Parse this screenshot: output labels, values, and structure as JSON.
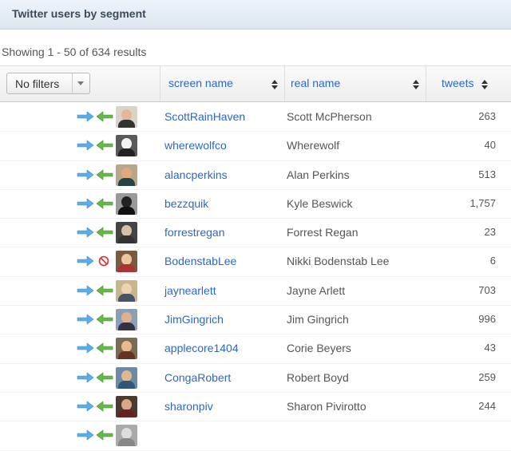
{
  "panel": {
    "title": "Twitter users by segment"
  },
  "results_text": "Showing 1 - 50 of 634 results",
  "filter": {
    "selected": "No filters"
  },
  "columns": {
    "screen_name": "screen name",
    "real_name": "real name",
    "tweets": "tweets"
  },
  "colors": {
    "link": "#2a68c7",
    "arrow_right": "#5aaee6",
    "arrow_left": "#66b84a",
    "block": "#d0302b"
  },
  "rows": [
    {
      "screen_name": "ScottRainHaven",
      "real_name": "Scott McPherson",
      "tweets": "263",
      "status_icon": "arrow-left-icon"
    },
    {
      "screen_name": "wherewolfco",
      "real_name": "Wherewolf",
      "tweets": "40",
      "status_icon": "arrow-left-icon"
    },
    {
      "screen_name": "alancperkins",
      "real_name": "Alan Perkins",
      "tweets": "513",
      "status_icon": "arrow-left-icon"
    },
    {
      "screen_name": "bezzquik",
      "real_name": "Kyle Beswick",
      "tweets": "1,757",
      "status_icon": "arrow-left-icon"
    },
    {
      "screen_name": "forrestregan",
      "real_name": "Forrest Regan",
      "tweets": "23",
      "status_icon": "arrow-left-icon"
    },
    {
      "screen_name": "BodenstabLee",
      "real_name": "Nikki Bodenstab Lee",
      "tweets": "6",
      "status_icon": "block-icon"
    },
    {
      "screen_name": "jaynearlett",
      "real_name": "Jayne Arlett",
      "tweets": "703",
      "status_icon": "arrow-left-icon"
    },
    {
      "screen_name": "JimGingrich",
      "real_name": "Jim Gingrich",
      "tweets": "996",
      "status_icon": "arrow-left-icon"
    },
    {
      "screen_name": "applecore1404",
      "real_name": "Corie Beyers",
      "tweets": "43",
      "status_icon": "arrow-left-icon"
    },
    {
      "screen_name": "CongaRobert",
      "real_name": "Robert Boyd",
      "tweets": "259",
      "status_icon": "arrow-left-icon"
    },
    {
      "screen_name": "sharonpiv",
      "real_name": "Sharon Pivirotto",
      "tweets": "244",
      "status_icon": "arrow-left-icon"
    },
    {
      "screen_name": "",
      "real_name": "",
      "tweets": "",
      "status_icon": "arrow-left-icon"
    }
  ]
}
